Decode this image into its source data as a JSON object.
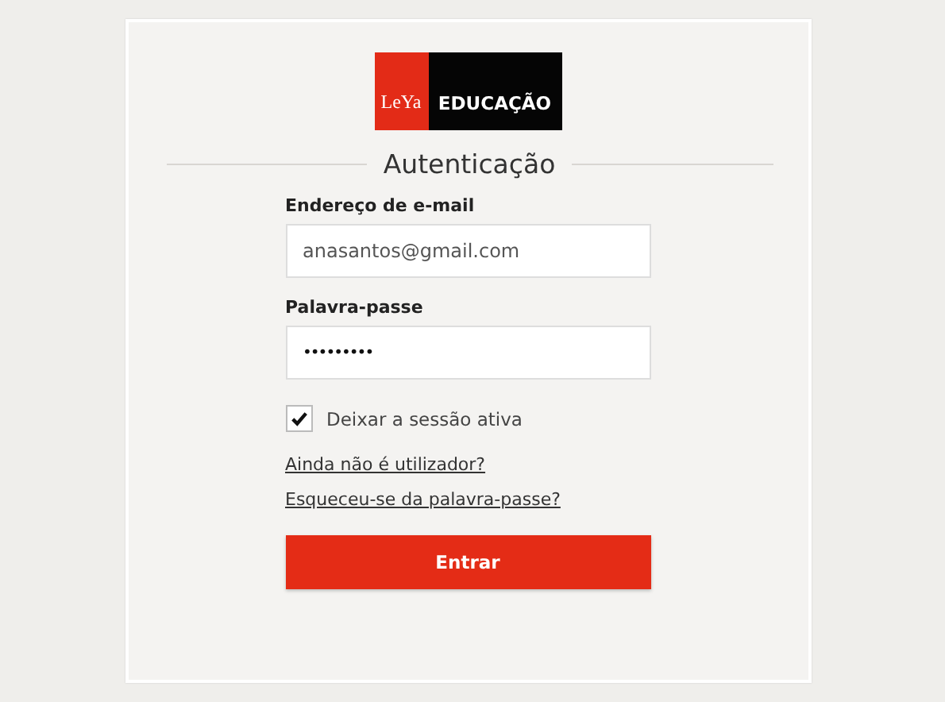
{
  "logo": {
    "brand": "LeYa",
    "product": "EDUCAÇÃO"
  },
  "heading": "Autenticação",
  "fields": [
    {
      "label": "Endereço de e-mail",
      "value": "anasantos@gmail.com",
      "kind": "text"
    },
    {
      "label": "Palavra-passe",
      "value": "•••••••••",
      "kind": "password"
    }
  ],
  "remember": {
    "label": "Deixar a sessão ativa",
    "checked": true
  },
  "links": [
    "Ainda não é utilizador?",
    "Esqueceu-se da palavra-passe?"
  ],
  "submit": "Entrar"
}
